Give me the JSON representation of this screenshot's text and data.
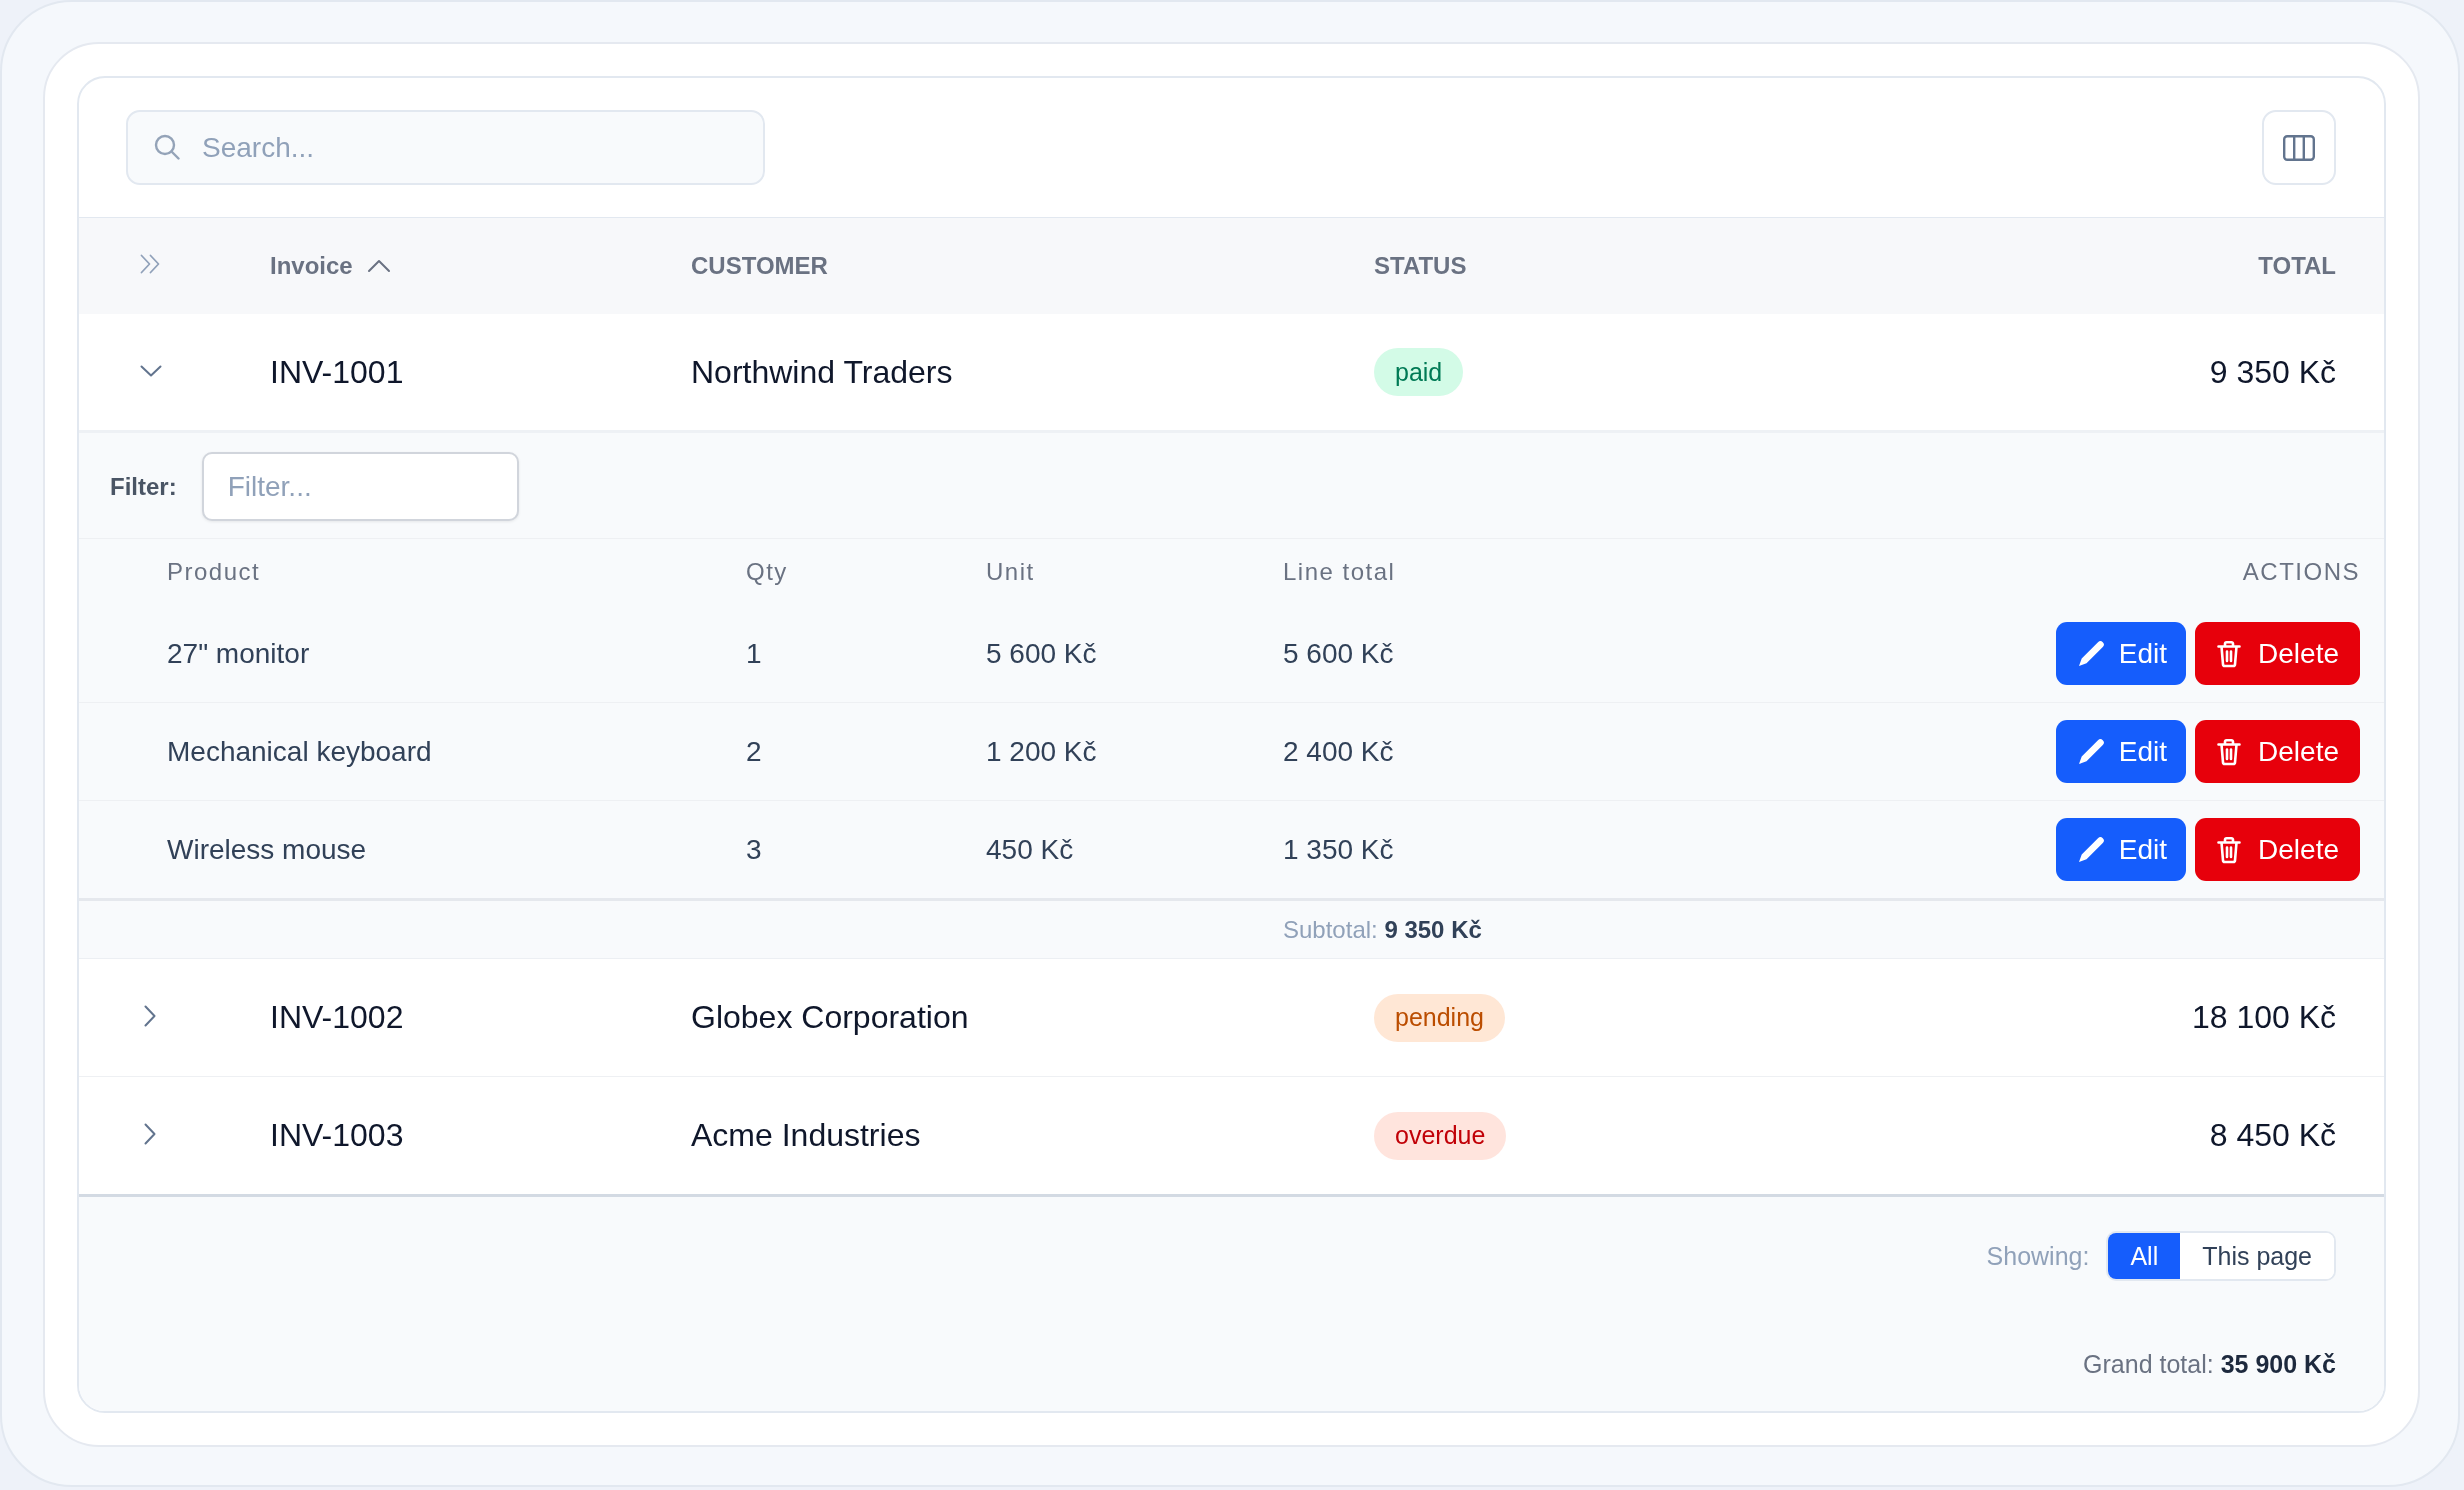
{
  "toolbar": {
    "search": {
      "placeholder": "Search..."
    }
  },
  "table": {
    "columns": [
      {
        "label": "Invoice",
        "sorted": true
      },
      {
        "label": "CUSTOMER"
      },
      {
        "label": "STATUS"
      },
      {
        "label": "TOTAL"
      }
    ],
    "rows": [
      {
        "invoice": "INV-1001",
        "customer": "Northwind Traders",
        "status": {
          "label": "paid",
          "color": "#007a55"
        },
        "total": "9 350 Kč",
        "expanded": true,
        "detail": {
          "filter": {
            "label": "Filter:",
            "placeholder": "Filter..."
          },
          "columns": [
            "Product",
            "Qty",
            "Unit",
            "Line total",
            "ACTIONS"
          ],
          "items": [
            {
              "product": "27\" monitor",
              "qty": "1",
              "unit": "5 600 Kč",
              "line_total": "5 600 Kč",
              "actions": [
                {
                  "kind": "edit",
                  "label": "Edit"
                },
                {
                  "kind": "delete",
                  "label": "Delete"
                }
              ]
            },
            {
              "product": "Mechanical keyboard",
              "qty": "2",
              "unit": "1 200 Kč",
              "line_total": "2 400 Kč",
              "actions": [
                {
                  "kind": "edit",
                  "label": "Edit"
                },
                {
                  "kind": "delete",
                  "label": "Delete"
                }
              ]
            },
            {
              "product": "Wireless mouse",
              "qty": "3",
              "unit": "450 Kč",
              "line_total": "1 350 Kč",
              "actions": [
                {
                  "kind": "edit",
                  "label": "Edit"
                },
                {
                  "kind": "delete",
                  "label": "Delete"
                }
              ]
            }
          ],
          "subtotal": "Subtotal: **9 350 Kč**"
        }
      },
      {
        "invoice": "INV-1002",
        "customer": "Globex Corporation",
        "status": {
          "label": "pending",
          "color": "#bb4d00"
        },
        "total": "18 100 Kč",
        "expanded": false
      },
      {
        "invoice": "INV-1003",
        "customer": "Acme Industries",
        "status": {
          "label": "overdue",
          "color": "#c10007"
        },
        "total": "8 450 Kč",
        "expanded": false
      }
    ]
  },
  "footer": {
    "showing": {
      "label": "Showing:",
      "options": [
        {
          "label": "All",
          "selected": true
        },
        {
          "label": "This page",
          "selected": false
        }
      ]
    },
    "grand_total": "Grand total: **35 900 Kč**"
  }
}
